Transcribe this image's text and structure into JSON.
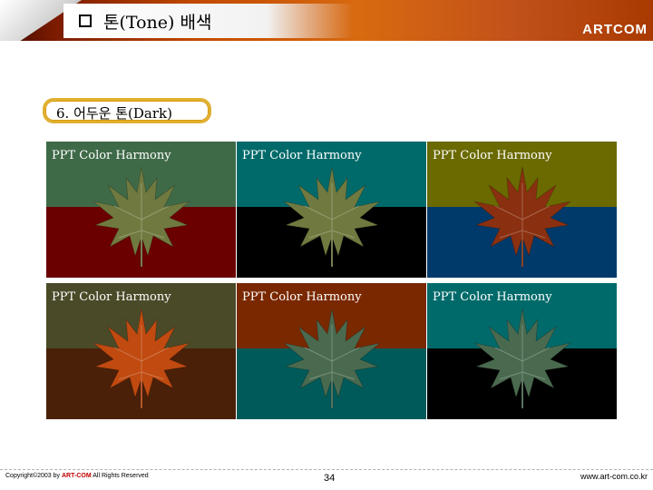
{
  "header": {
    "title": "톤(Tone) 배색",
    "brand": "ARTCOM",
    "bullet_icon": "square-bullet-icon",
    "band_colors": [
      "#7a1a00",
      "#d86a10"
    ]
  },
  "section": {
    "label": "6. 어두운 톤(Dark)",
    "border_color": "#e0b030"
  },
  "swatches": [
    {
      "label": "PPT Color Harmony",
      "top_color": "#3f6a48",
      "bottom_color": "#6a0000",
      "leaf_color": "#707a40",
      "leaf_icon": "maple-leaf-icon"
    },
    {
      "label": "PPT Color Harmony",
      "top_color": "#006a6a",
      "bottom_color": "#000000",
      "leaf_color": "#707a40",
      "leaf_icon": "maple-leaf-icon"
    },
    {
      "label": "PPT Color Harmony",
      "top_color": "#6a6a00",
      "bottom_color": "#003a6a",
      "leaf_color": "#8a3010",
      "leaf_icon": "maple-leaf-icon"
    },
    {
      "label": "PPT Color Harmony",
      "top_color": "#4a4a28",
      "bottom_color": "#4a2008",
      "leaf_color": "#c04a10",
      "leaf_icon": "maple-leaf-icon"
    },
    {
      "label": "PPT Color Harmony",
      "top_color": "#7a2800",
      "bottom_color": "#005a5a",
      "leaf_color": "#4a6a50",
      "leaf_icon": "maple-leaf-icon"
    },
    {
      "label": "PPT Color Harmony",
      "top_color": "#006a6a",
      "bottom_color": "#000000",
      "leaf_color": "#4a6a50",
      "leaf_icon": "maple-leaf-icon"
    }
  ],
  "footer": {
    "copyright_prefix": "Copyright©2003 by ",
    "copyright_brand": "ART-COM",
    "copyright_suffix": " All Rights Reserved",
    "page_number": "34",
    "website": "www.art-com.co.kr"
  }
}
